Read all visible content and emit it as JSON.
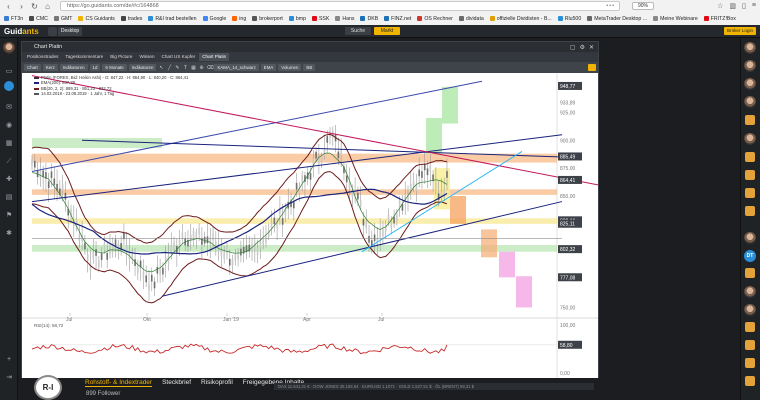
{
  "browser": {
    "url": "https://go.guidants.com/de/#c/164868",
    "zoom": "90%",
    "bookmarks": [
      {
        "label": "FT3n",
        "color": "#3a7bd5"
      },
      {
        "label": "CMC",
        "color": "#4a4a4a"
      },
      {
        "label": "GMT",
        "color": "#777777"
      },
      {
        "label": "CS Guidants",
        "color": "#f0b400"
      },
      {
        "label": "trades",
        "color": "#444444"
      },
      {
        "label": "R&I trad bestellen",
        "color": "#2a8fd8"
      },
      {
        "label": "Google",
        "color": "#4285f4"
      },
      {
        "label": "ing",
        "color": "#ff6200"
      },
      {
        "label": "brokerport",
        "color": "#555555"
      },
      {
        "label": "bmp",
        "color": "#2a8fd8"
      },
      {
        "label": "SSK",
        "color": "#e30613"
      },
      {
        "label": "Hans",
        "color": "#888888"
      },
      {
        "label": "DKB",
        "color": "#1e6fb5"
      },
      {
        "label": "FINZ.net",
        "color": "#1e6fb5"
      },
      {
        "label": "OS Rechner",
        "color": "#d0342c"
      },
      {
        "label": "dividata",
        "color": "#6a6a6a"
      },
      {
        "label": "offizielle Dividisten - B...",
        "color": "#e0a000"
      },
      {
        "label": "Rlu500",
        "color": "#2a8fd8"
      },
      {
        "label": "MetaTrader Desktop ...",
        "color": "#666666"
      },
      {
        "label": "Meine Webinare",
        "color": "#888888"
      },
      {
        "label": "FRITZ!Box",
        "color": "#e30613"
      }
    ]
  },
  "app": {
    "logo_main": "Guid",
    "logo_accent": "ants",
    "desktop_tab": "Desktop",
    "search_label": "Suche",
    "market_label": "Markt",
    "broker_label": "Broker Login"
  },
  "chart_window": {
    "title": "Chart Platin",
    "tabs": [
      "Positionstrades",
      "Tageskommentare",
      "Big Picture",
      "Wissen",
      "Chart US Kupfer",
      "Chart Platin"
    ],
    "active_tab": "Chart Platin",
    "toolbar": {
      "chart_btn": "Chart",
      "type_btn": "Kerz",
      "indicators_btn": "Indikatoren",
      "period_btn": "1d",
      "range_btn": "6 Monate",
      "indikator_btn": "Indikatoren",
      "studies": [
        "KAMA_14_schwarz",
        "EMA",
        "Volumen",
        "BB"
      ]
    },
    "legend": [
      {
        "label": "Platin (FOREX, Bid: Heikin Ashi) - O: 847,22 · H: 864,90 · L: 840,20 · C: 864,41",
        "color": "#333333"
      },
      {
        "label": "EMA(200): 837,39",
        "color": "#1a237e"
      },
      {
        "label": "BB(20, 2, 2): 889,31 · 851,23 · 832,72",
        "color": "#6d1b1b"
      },
      {
        "label": "14.03.2018 - 23.08.2019 · 1 Jahr, 1 Tag",
        "color": "#555555"
      }
    ],
    "rsi_label": "RSI(14): 58,72",
    "rsi_levels": [
      "100,00",
      "58,80",
      "0,00"
    ]
  },
  "chart_data": {
    "type": "line",
    "x_labels": [
      "Jul",
      "Okt",
      "Jan '19",
      "Apr",
      "Jul"
    ],
    "price_labels": [
      {
        "value": "948,77",
        "hl": true
      },
      {
        "value": "933,89",
        "hl": false
      },
      {
        "value": "925,00",
        "hl": false
      },
      {
        "value": "900,00",
        "hl": false
      },
      {
        "value": "885,49",
        "hl": true
      },
      {
        "value": "875,00",
        "hl": false
      },
      {
        "value": "864,41",
        "hl": true
      },
      {
        "value": "850,00",
        "hl": false
      },
      {
        "value": "828,16",
        "hl": true
      },
      {
        "value": "825,11",
        "hl": true
      },
      {
        "value": "802,32",
        "hl": true
      },
      {
        "value": "777,08",
        "hl": true
      },
      {
        "value": "750,00",
        "hl": false
      }
    ],
    "rsi_value": 58.72
  },
  "profile": {
    "logo_text": "R-I",
    "tabs": [
      "Rohstoff- & Indextrader",
      "Steckbrief",
      "Risikoprofil",
      "Freigegebene Inhalte"
    ],
    "active_tab": "Rohstoff- & Indextrader",
    "followers": "899 Follower",
    "ticker": "DAX 11.641,31 €   ·   DOW JONES 25.193,64   ·   EUR/USD 1,1071   ·   GOLD 1.527,51 $   ·   ÖL (BRENT) 59,31 $"
  }
}
